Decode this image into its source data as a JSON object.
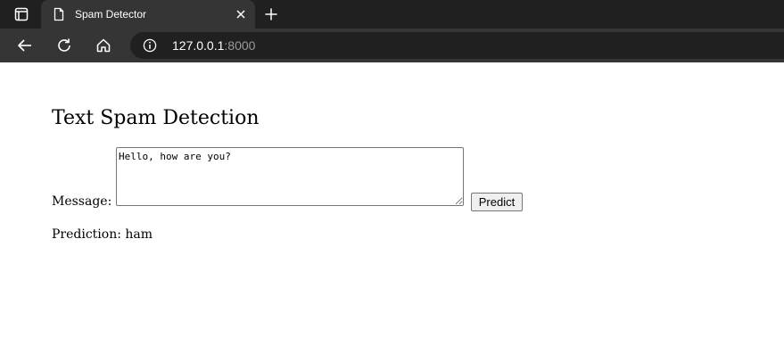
{
  "browser": {
    "tab": {
      "title": "Spam Detector",
      "favicon": "document-icon"
    },
    "address_bar": {
      "host": "127.0.0.1",
      "port": ":8000"
    },
    "icons": {
      "tab_menu": "tab-menu-icon",
      "close": "close-icon",
      "new_tab": "plus-icon",
      "back": "back-arrow-icon",
      "reload": "reload-icon",
      "home": "home-icon",
      "site_info": "info-icon"
    },
    "colors": {
      "tabstrip": "#202020",
      "toolbar": "#353535",
      "omnibox": "#202020"
    }
  },
  "page": {
    "title": "Text Spam Detection",
    "form": {
      "message_label": "Message:",
      "message_value": "Hello, how are you?",
      "submit_label": "Predict"
    },
    "result": {
      "label": "Prediction:",
      "value": "ham"
    }
  }
}
